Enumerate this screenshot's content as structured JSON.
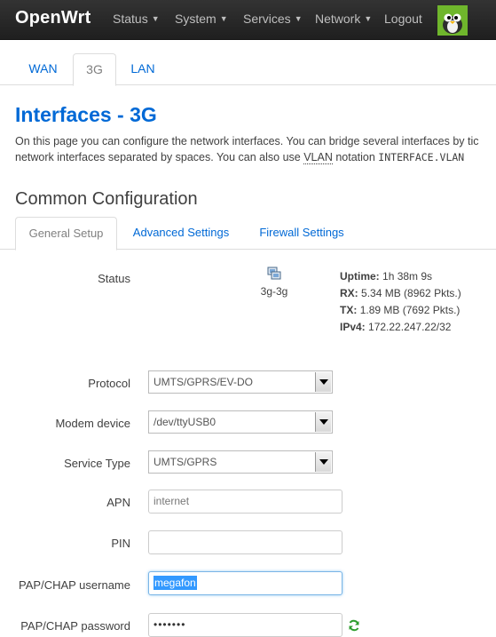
{
  "brand": "OpenWrt",
  "nav": {
    "items": [
      {
        "label": "Status",
        "caret": "▼"
      },
      {
        "label": "System",
        "caret": "▼"
      },
      {
        "label": "Services",
        "caret": "▼"
      },
      {
        "label": "Network",
        "caret": "▼"
      },
      {
        "label": "Logout"
      }
    ]
  },
  "tabs": [
    "WAN",
    "3G",
    "LAN"
  ],
  "active_tab": "3G",
  "page": {
    "title": "Interfaces - 3G",
    "desc_line1": "On this page you can configure the network interfaces. You can bridge several interfaces by tic",
    "desc_line2_pre": "network interfaces separated by spaces. You can also use ",
    "desc_vlan": "VLAN",
    "desc_line2_mid": " notation ",
    "desc_mono": "INTERFACE.VLAN"
  },
  "section": {
    "title": "Common Configuration",
    "subtabs": [
      "General Setup",
      "Advanced Settings",
      "Firewall Settings"
    ],
    "active_subtab": "General Setup"
  },
  "status": {
    "label": "Status",
    "ifname": "3g-3g",
    "uptime_label": "Uptime:",
    "uptime": "1h 38m 9s",
    "rx_label": "RX:",
    "rx": "5.34 MB (8962 Pkts.)",
    "tx_label": "TX:",
    "tx": "1.89 MB (7692 Pkts.)",
    "ipv4_label": "IPv4:",
    "ipv4": "172.22.247.22/32"
  },
  "form": {
    "protocol_label": "Protocol",
    "protocol": "UMTS/GPRS/EV-DO",
    "modem_label": "Modem device",
    "modem": "/dev/ttyUSB0",
    "service_label": "Service Type",
    "service": "UMTS/GPRS",
    "apn_label": "APN",
    "apn": "internet",
    "pin_label": "PIN",
    "pin": "",
    "user_label": "PAP/CHAP username",
    "user": "megafon",
    "pass_label": "PAP/CHAP password",
    "pass": "•••••••"
  },
  "colors": {
    "accent": "#0069d6",
    "navbar": "#222222",
    "logo_bg": "#6fb62c"
  }
}
